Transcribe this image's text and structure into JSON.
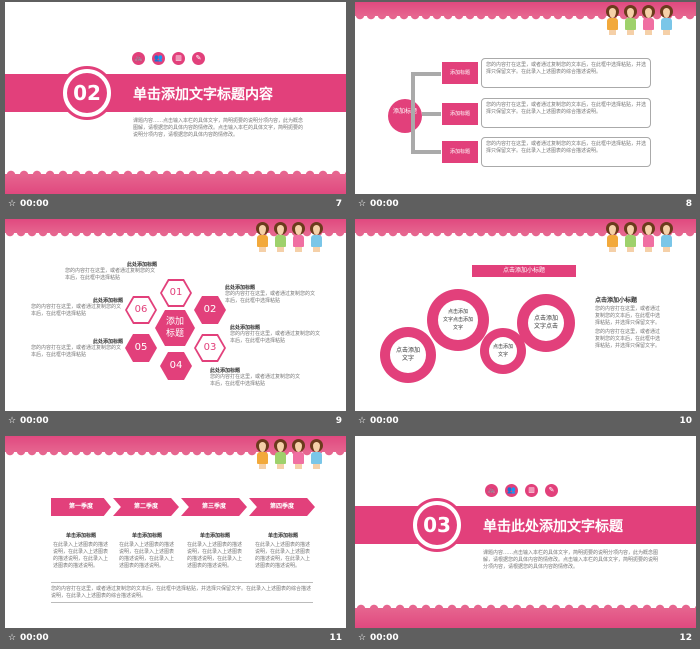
{
  "colors": {
    "accent": "#e2407b",
    "background": "#5f5f5f"
  },
  "caption_time": "00:00",
  "slides": {
    "s7": {
      "num": "7",
      "section_num": "02",
      "title": "单击添加文字标题内容",
      "body": "课题内容……点击输入本栏的具体文字，简明扼要的说明分项内容，此为概念图解，请根据您的具体内容酌情修改。点击输入本栏的具体文字，简明扼要的说明分项内容，请根据您的具体内容酌情修改。"
    },
    "s8": {
      "num": "8",
      "center_label": "添加标题",
      "items": [
        {
          "label": "添加标题",
          "text": "您的内容打在这里，或者通过复制您的文本后，在此框中选择粘贴，并选择只保留文字。在此录入上述图表的综合描述说明。"
        },
        {
          "label": "添加标题",
          "text": "您的内容打在这里，或者通过复制您的文本后，在此框中选择粘贴，并选择只保留文字。在此录入上述图表的综合描述说明。"
        },
        {
          "label": "添加标题",
          "text": "您的内容打在这里，或者通过复制您的文本后，在此框中选择粘贴，并选择只保留文字。在此录入上述图表的综合描述说明。"
        }
      ]
    },
    "s9": {
      "num": "9",
      "center": "添加\n标题",
      "hex_labels": [
        "01",
        "02",
        "03",
        "04",
        "05",
        "06"
      ],
      "blocks": [
        {
          "title": "此处添加标题",
          "text": "您的内容打在这里，或者通过复制您的文本后，在此框中选择粘贴"
        },
        {
          "title": "此处添加标题",
          "text": "您的内容打在这里，或者通过复制您的文本后，在此框中选择粘贴"
        },
        {
          "title": "此处添加标题",
          "text": "您的内容打在这里，或者通过复制您的文本后，在此框中选择粘贴"
        },
        {
          "title": "此处添加标题",
          "text": "您的内容打在这里，或者通过复制您的文本后，在此框中选择粘贴"
        },
        {
          "title": "此处添加标题",
          "text": "您的内容打在这里，或者通过复制您的文本后，在此框中选择粘贴"
        },
        {
          "title": "此处添加标题",
          "text": "您的内容打在这里，或者通过复制您的文本后，在此框中选择粘贴"
        }
      ]
    },
    "s10": {
      "num": "10",
      "top_label": "点击添加小标题",
      "gears": [
        "点击添加\n文字",
        "点击添加\n文字点击添加\n文字",
        "点击添加\n文字",
        "点击添加\n文字点击"
      ],
      "side_title": "点击添加小标题",
      "side_text_1": "您的内容打在这里，或者通过复制您的文本后，在此框中选择粘贴，并选择只保留文字。",
      "side_text_2": "您的内容打在这里，或者通过复制您的文本后，在此框中选择粘贴，并选择只保留文字。"
    },
    "s11": {
      "num": "11",
      "quarters": [
        "第一季度",
        "第二季度",
        "第三季度",
        "第四季度"
      ],
      "col_title": "单击添加标题",
      "col_text": "在此录入上述图表的描述说明，在此录入上述图表的描述说明，在此录入上述图表的描述说明。",
      "footer": "您的内容打在这里，或者通过复制您的文本后，在此框中选择粘贴，并选择只保留文字。在此录入上述图表的综合描述说明，在此录入上述图表的综合描述说明。"
    },
    "s12": {
      "num": "12",
      "section_num": "03",
      "title": "单击此处添加文字标题",
      "body": "课题内容……点击输入本栏的具体文字，简明扼要的说明分项内容，此为概念图解，请根据您的具体内容酌情修改。点击输入本栏的具体文字，简明扼要的说明分项内容，请根据您的具体内容酌情修改。"
    }
  },
  "icons": [
    "bike-icon",
    "people-icon",
    "chart-icon",
    "book-icon"
  ]
}
